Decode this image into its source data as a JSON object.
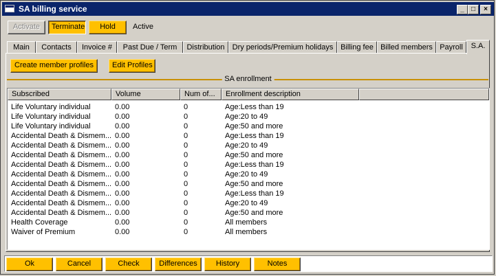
{
  "window": {
    "title": "SA billing service"
  },
  "toolbar": {
    "activate_label": "Activate",
    "terminate_label": "Terminate",
    "hold_label": "Hold",
    "status_text": "Active"
  },
  "tabs": [
    {
      "label": "Main"
    },
    {
      "label": "Contacts"
    },
    {
      "label": "Invoice #"
    },
    {
      "label": "Past Due / Term"
    },
    {
      "label": "Distribution"
    },
    {
      "label": "Dry periods/Premium holidays"
    },
    {
      "label": "Billing fee"
    },
    {
      "label": "Billed members"
    },
    {
      "label": "Payroll"
    },
    {
      "label": "S.A."
    }
  ],
  "active_tab": "S.A.",
  "profile_buttons": {
    "create_label": "Create member profiles",
    "edit_label": "Edit Profiles"
  },
  "section_label": "SA enrollment",
  "table": {
    "columns": [
      "Subscribed",
      "Volume",
      "Num of...",
      "Enrollment description"
    ],
    "rows": [
      [
        "Life Voluntary individual",
        "0.00",
        "0",
        "Age:Less than 19"
      ],
      [
        "Life Voluntary individual",
        "0.00",
        "0",
        "Age:20 to 49"
      ],
      [
        "Life Voluntary individual",
        "0.00",
        "0",
        "Age:50 and more"
      ],
      [
        "Accidental Death & Dismem...",
        "0.00",
        "0",
        "Age:Less than 19"
      ],
      [
        "Accidental Death & Dismem...",
        "0.00",
        "0",
        "Age:20 to 49"
      ],
      [
        "Accidental Death & Dismem...",
        "0.00",
        "0",
        "Age:50 and more"
      ],
      [
        "Accidental Death & Dismem...",
        "0.00",
        "0",
        "Age:Less than 19"
      ],
      [
        "Accidental Death & Dismem...",
        "0.00",
        "0",
        "Age:20 to 49"
      ],
      [
        "Accidental Death & Dismem...",
        "0.00",
        "0",
        "Age:50 and more"
      ],
      [
        "Accidental Death & Dismem...",
        "0.00",
        "0",
        "Age:Less than 19"
      ],
      [
        "Accidental Death & Dismem...",
        "0.00",
        "0",
        "Age:20 to 49"
      ],
      [
        "Accidental Death & Dismem...",
        "0.00",
        "0",
        "Age:50 and more"
      ],
      [
        "Health Coverage",
        "0.00",
        "0",
        "All members"
      ],
      [
        "Waiver of Premium",
        "0.00",
        "0",
        "All members"
      ]
    ]
  },
  "bottom_buttons": {
    "ok_label": "Ok",
    "cancel_label": "Cancel",
    "check_label": "Check",
    "differences_label": "Differences",
    "history_label": "History",
    "notes_label": "Notes"
  },
  "colors": {
    "titlebar": "#0a246a",
    "button": "#ffc000",
    "face": "#d4d0c8"
  }
}
